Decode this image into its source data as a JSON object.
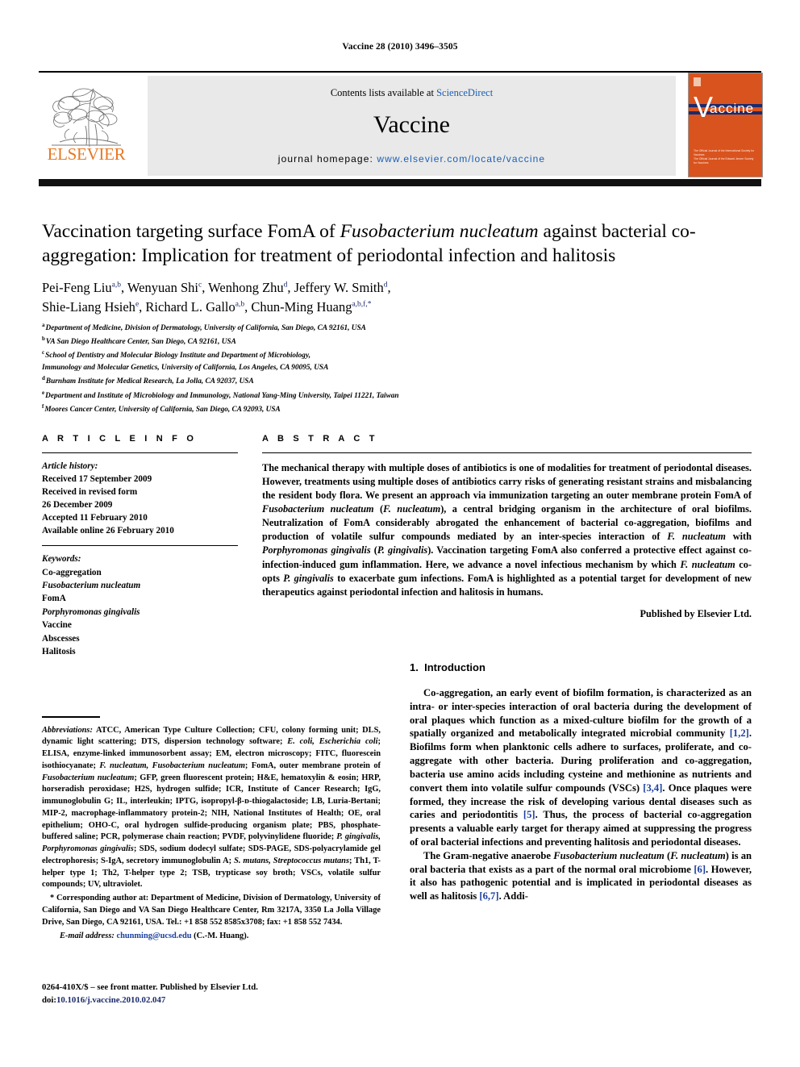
{
  "running_head": "Vaccine 28 (2010) 3496–3505",
  "masthead": {
    "contents_prefix": "Contents lists available at ",
    "sciencedirect": "ScienceDirect",
    "journal_name": "Vaccine",
    "homepage_label": "journal homepage:",
    "homepage_url": "www.elsevier.com/locate/vaccine",
    "publisher_logo_text": "ELSEVIER",
    "cover": {
      "letter": "V",
      "word": "accine",
      "footer_line1": "The Official Journal of the International Society for Vaccines",
      "footer_line2": "The Official Journal of the Edward Jenner Society for Vaccines"
    },
    "accent_orange": "#E87722",
    "cover_orange": "#D9531E",
    "link_blue": "#1a5fb4",
    "band_gray": "#e9e9e9"
  },
  "article": {
    "title": "Vaccination targeting surface FomA of Fusobacterium nucleatum against bacterial co-aggregation: Implication for treatment of periodontal infection and halitosis",
    "title_part1": "Vaccination targeting surface FomA of ",
    "title_italic": "Fusobacterium nucleatum",
    "title_part2": " against bacterial co-aggregation: Implication for treatment of periodontal infection and halitosis",
    "authors": [
      {
        "name": "Pei-Feng Liu",
        "marks": "a,b"
      },
      {
        "name": "Wenyuan Shi",
        "marks": "c"
      },
      {
        "name": "Wenhong Zhu",
        "marks": "d"
      },
      {
        "name": "Jeffery W. Smith",
        "marks": "d"
      },
      {
        "name": "Shie-Liang Hsieh",
        "marks": "e"
      },
      {
        "name": "Richard L. Gallo",
        "marks": "a,b"
      },
      {
        "name": "Chun-Ming Huang",
        "marks": "a,b,f,*"
      }
    ],
    "affiliations": [
      {
        "mark": "a",
        "text": "Department of Medicine, Division of Dermatology, University of California, San Diego, CA 92161, USA"
      },
      {
        "mark": "b",
        "text": "VA San Diego Healthcare Center, San Diego, CA 92161, USA"
      },
      {
        "mark": "c",
        "text": "School of Dentistry and Molecular Biology Institute and Department of Microbiology,"
      },
      {
        "mark": "",
        "text": "Immunology and Molecular Genetics, University of California, Los Angeles, CA 90095, USA"
      },
      {
        "mark": "d",
        "text": "Burnham Institute for Medical Research, La Jolla, CA 92037, USA"
      },
      {
        "mark": "e",
        "text": "Department and Institute of Microbiology and Immunology, National Yang-Ming University, Taipei 11221, Taiwan"
      },
      {
        "mark": "f",
        "text": "Moores Cancer Center, University of California, San Diego, CA 92093, USA"
      }
    ]
  },
  "article_info": {
    "heading": "A R T I C L E  I N F O",
    "history_label": "Article history:",
    "history": [
      "Received 17 September 2009",
      "Received in revised form",
      "26 December 2009",
      "Accepted 11 February 2010",
      "Available online 26 February 2010"
    ],
    "keywords_label": "Keywords:",
    "keywords": [
      {
        "text": "Co-aggregation",
        "italic": false
      },
      {
        "text": "Fusobacterium nucleatum",
        "italic": true
      },
      {
        "text": "FomA",
        "italic": false
      },
      {
        "text": "Porphyromonas gingivalis",
        "italic": true
      },
      {
        "text": "Vaccine",
        "italic": false
      },
      {
        "text": "Abscesses",
        "italic": false
      },
      {
        "text": "Halitosis",
        "italic": false
      }
    ]
  },
  "abstract": {
    "heading": "A B S T R A C T",
    "text_pre": "The mechanical therapy with multiple doses of antibiotics is one of modalities for treatment of periodontal diseases. However, treatments using multiple doses of antibiotics carry risks of generating resistant strains and misbalancing the resident body flora. We present an approach via immunization targeting an outer membrane protein FomA of ",
    "it1": "Fusobacterium nucleatum",
    "mid1": " (",
    "it2": "F. nucleatum",
    "mid2": "), a central bridging organism in the architecture of oral biofilms. Neutralization of FomA considerably abrogated the enhancement of bacterial co-aggregation, biofilms and production of volatile sulfur compounds mediated by an inter-species interaction of ",
    "it3": "F. nucleatum",
    "mid3": " with ",
    "it4": "Porphyromonas gingivalis",
    "mid4": " (",
    "it5": "P. gingivalis",
    "mid5": "). Vaccination targeting FomA also conferred a protective effect against co-infection-induced gum inflammation. Here, we advance a novel infectious mechanism by which ",
    "it6": "F. nucleatum",
    "mid6": " co-opts ",
    "it7": "P. gingivalis",
    "text_post": " to exacerbate gum infections. FomA is highlighted as a potential target for development of new therapeutics against periodontal infection and halitosis in humans.",
    "publisher": "Published by Elsevier Ltd."
  },
  "footnotes": {
    "abbrev_label": "Abbreviations:",
    "abbrev_pre": "  ATCC, American Type Culture Collection; CFU, colony forming unit; DLS, dynamic light scattering; DTS, dispersion technology software; ",
    "abbrev_it1": "E. coli, Escherichia coli",
    "abbrev_p2": "; ELISA, enzyme-linked immunosorbent assay; EM, electron microscopy; FITC, fluorescein isothiocyanate; ",
    "abbrev_it2": "F. nucleatum, Fusobacterium nucleatum",
    "abbrev_p3": "; FomA, outer membrane protein of ",
    "abbrev_it3": "Fusobacterium nucleatum",
    "abbrev_p4": "; GFP, green fluorescent protein; H&E, hematoxylin & eosin; HRP, horseradish peroxidase; H2S, hydrogen sulfide; ICR, Institute of Cancer Research; IgG, immunoglobulin G; IL, interleukin; IPTG, isopropyl-β-ᴅ-thiogalactoside; LB, Luria-Bertani; MIP-2, macrophage-inflammatory protein-2; NIH, National Institutes of Health; OE, oral epithelium; OHO-C, oral hydrogen sulfide-producing organism plate; PBS, phosphate-buffered saline; PCR, polymerase chain reaction; PVDF, polyvinylidene fluoride; ",
    "abbrev_it4": "P. gingivalis, Porphyromonas gingivalis",
    "abbrev_p5": "; SDS, sodium dodecyl sulfate; SDS-PAGE, SDS-polyacrylamide gel electrophoresis; S-IgA, secretory immunoglobulin A; ",
    "abbrev_it5": "S. mutans, Streptococcus mutans",
    "abbrev_p6": "; Th1, T-helper type 1; Th2, T-helper type 2; TSB, trypticase soy broth; VSCs, volatile sulfur compounds; UV, ultraviolet.",
    "corresponding": "* Corresponding author at: Department of Medicine, Division of Dermatology, University of California, San Diego and VA San Diego Healthcare Center, Rm 3217A, 3350 La Jolla Village Drive, San Diego, CA 92161, USA. Tel.: +1 858 552 8585x3708; fax: +1 858 552 7434.",
    "email_label": "E-mail address:",
    "email": "chunming@ucsd.edu",
    "email_owner": " (C.-M. Huang).",
    "imprint_line1": "0264-410X/$ – see front matter. Published by Elsevier Ltd.",
    "imprint_doi_label": "doi:",
    "imprint_doi": "10.1016/j.vaccine.2010.02.047"
  },
  "body": {
    "section_number": "1.",
    "section_title": "Introduction",
    "para1_a": "Co-aggregation, an early event of biofilm formation, is characterized as an intra- or inter-species interaction of oral bacteria during the development of oral plaques which function as a mixed-culture biofilm for the growth of a spatially organized and metabolically integrated microbial community ",
    "para1_ref1": "[1,2]",
    "para1_b": ". Biofilms form when planktonic cells adhere to surfaces, proliferate, and co-aggregate with other bacteria. During proliferation and co-aggregation, bacteria use amino acids including cysteine and methionine as nutrients and convert them into volatile sulfur compounds (VSCs) ",
    "para1_ref2": "[3,4]",
    "para1_c": ". Once plaques were formed, they increase the risk of developing various dental diseases such as caries and periodontitis ",
    "para1_ref3": "[5]",
    "para1_d": ". Thus, the process of bacterial co-aggregation presents a valuable early target for therapy aimed at suppressing the progress of oral bacterial infections and preventing halitosis and periodontal diseases.",
    "para2_a": "The Gram-negative anaerobe ",
    "para2_it1": "Fusobacterium nucleatum",
    "para2_b": " (",
    "para2_it2": "F. nucleatum",
    "para2_c": ") is an oral bacteria that exists as a part of the normal oral microbiome ",
    "para2_ref1": "[6]",
    "para2_d": ". However, it also has pathogenic potential and is implicated in periodontal diseases as well as halitosis ",
    "para2_ref2": "[6,7]",
    "para2_e": ". Addi-"
  }
}
